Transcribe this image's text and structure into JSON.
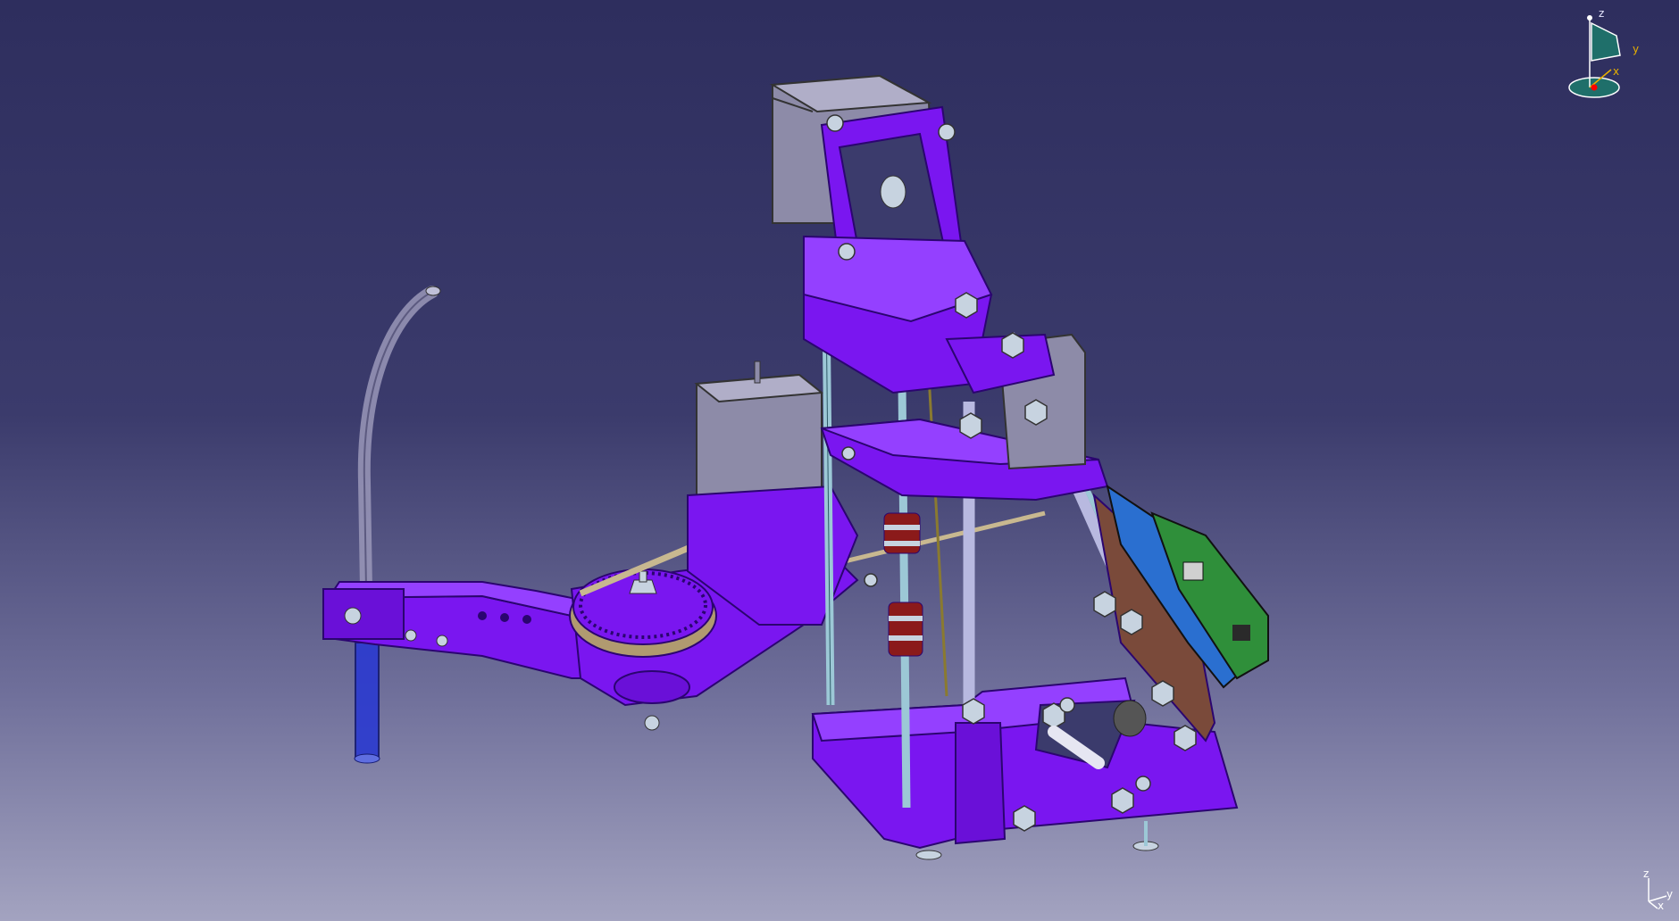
{
  "colors": {
    "background_top": "#2e2e5e",
    "background_bottom": "#a3a3c0",
    "part_purple": "#7a16f0",
    "part_purple_dark": "#4d0aa8",
    "motor_grey": "#8d8ba8",
    "belt_tan": "#c8b890",
    "pulley_rim": "#b09a70",
    "rod_steel": "#9cc8d6",
    "fastener": "#c7d3e0",
    "coupler_red": "#8b1a1a",
    "board_green": "#2f8f3a",
    "board_blue": "#2a6fd0",
    "board_brown": "#7a4a3a",
    "tube_blue": "#2b3ad0",
    "compass_teal": "#1f6f6a",
    "compass_y_axis": "#e8b000",
    "compass_dot": "#ff0000"
  },
  "compass": {
    "z": "z",
    "y": "y",
    "x": "x"
  },
  "mini_axis": {
    "z": "z",
    "y": "y",
    "x": "x"
  }
}
